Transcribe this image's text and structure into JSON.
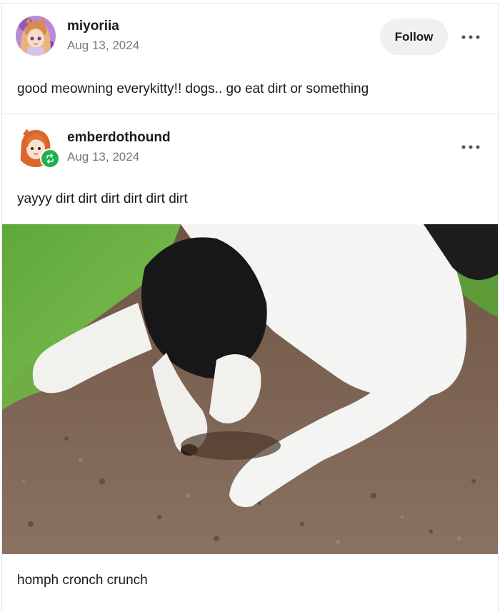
{
  "post": {
    "author": "miyoriia",
    "date": "Aug 13, 2024",
    "follow_label": "Follow",
    "text": "good meowning everykitty!! dogs.. go eat dirt or something"
  },
  "reblog": {
    "author": "emberdothound",
    "date": "Aug 13, 2024",
    "text": "yayyy dirt dirt dirt dirt dirt dirt",
    "caption": "homph cronch crunch"
  },
  "icons": {
    "more": "more-options-icon",
    "reblog": "reblog-icon"
  },
  "colors": {
    "reblog_badge": "#22b14c",
    "follow_bg": "#eef0f2",
    "date_text": "#6f7a85"
  }
}
